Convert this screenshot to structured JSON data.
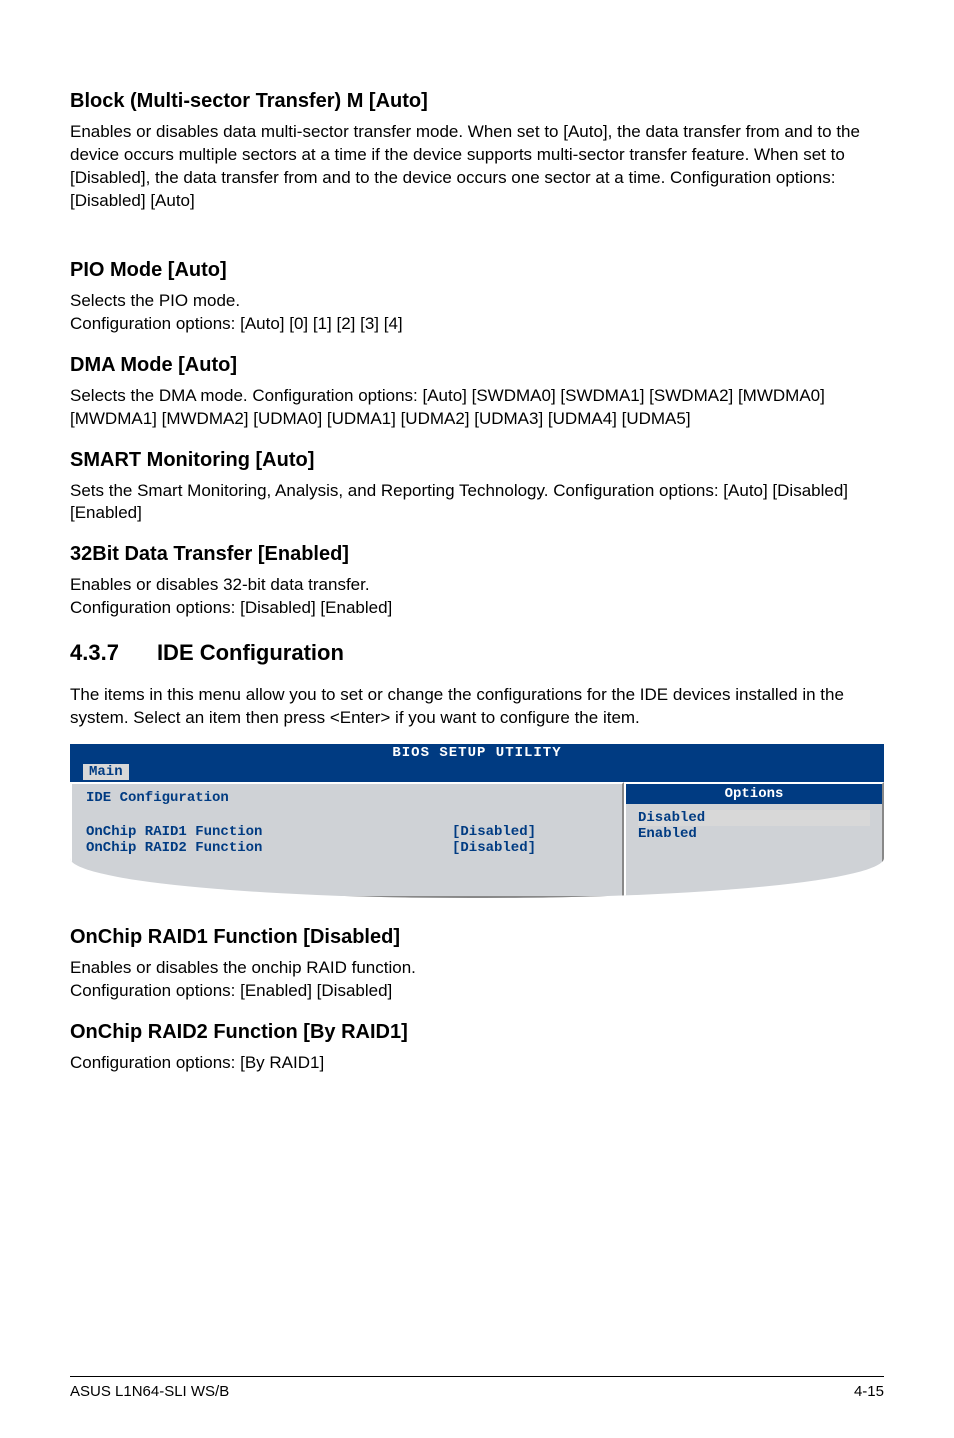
{
  "s1": {
    "h": "Block (Multi-sector Transfer) M [Auto]",
    "p": "Enables or disables data multi-sector transfer mode. When set to [Auto], the data transfer from and to the device occurs multiple sectors at a time if the device supports multi-sector transfer feature. When set to [Disabled], the data transfer from and to the device occurs one sector at a time. Configuration options: [Disabled] [Auto]"
  },
  "s2": {
    "h": "PIO Mode [Auto]",
    "p1": "Selects the PIO mode.",
    "p2": "Configuration options: [Auto] [0] [1] [2] [3] [4]"
  },
  "s3": {
    "h": "DMA Mode [Auto]",
    "p": "Selects the DMA mode. Configuration options: [Auto] [SWDMA0] [SWDMA1] [SWDMA2] [MWDMA0] [MWDMA1] [MWDMA2] [UDMA0] [UDMA1] [UDMA2] [UDMA3] [UDMA4] [UDMA5]"
  },
  "s4": {
    "h": "SMART Monitoring [Auto]",
    "p": "Sets the Smart Monitoring, Analysis, and Reporting Technology. Configuration options: [Auto] [Disabled] [Enabled]"
  },
  "s5": {
    "h": "32Bit Data Transfer [Enabled]",
    "p1": "Enables or disables 32-bit data transfer.",
    "p2": "Configuration options: [Disabled] [Enabled]"
  },
  "h2": {
    "num": "4.3.7",
    "title": "IDE Configuration",
    "p": "The items in this menu allow you to set or change the configurations for the IDE devices installed in the system. Select an item then press <Enter> if you want to configure the item."
  },
  "bios": {
    "header": "BIOS SETUP UTILITY",
    "tab": "Main",
    "left_title": "IDE Configuration",
    "rows": [
      {
        "label": "OnChip RAID1 Function",
        "value": "[Disabled]"
      },
      {
        "label": "OnChip RAID2 Function",
        "value": "[Disabled]"
      }
    ],
    "opt_head": "Options",
    "opts": [
      "Disabled",
      "Enabled"
    ]
  },
  "s6": {
    "h": "OnChip RAID1 Function [Disabled]",
    "p1": "Enables or disables the onchip RAID function.",
    "p2": "Configuration options: [Enabled] [Disabled]"
  },
  "s7": {
    "h": "OnChip RAID2 Function [By RAID1]",
    "p": "Configuration options: [By RAID1]"
  },
  "footer": {
    "left": "ASUS L1N64-SLI WS/B",
    "right": "4-15"
  }
}
